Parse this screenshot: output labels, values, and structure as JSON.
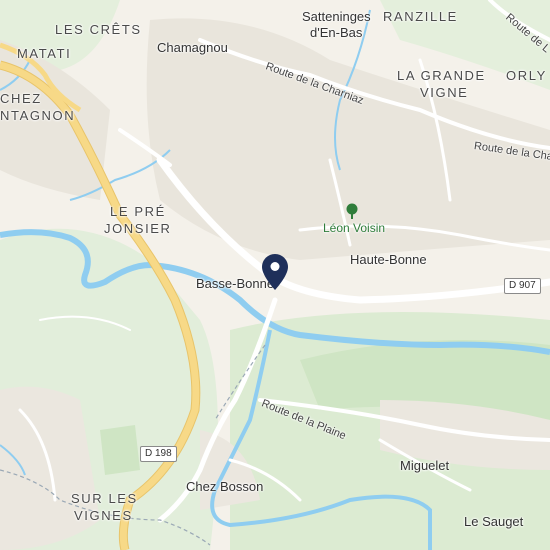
{
  "map": {
    "colors": {
      "land": "#f4f1ea",
      "green": "#dcebd2",
      "forest": "#cfe5c4",
      "water": "#8fcdf0",
      "major_road": "#f7d987",
      "road": "#ffffff",
      "built": "#e6e2d8",
      "pin": "#1e2f5a"
    },
    "labels": {
      "les_crets": "LES CRÊTS",
      "satteninges": "Satteninges",
      "den_bas": "d'En-Bas",
      "ranzille": "RANZILLE",
      "matati": "MATATI",
      "chamagnou": "Chamagnou",
      "la_grande": "LA GRANDE",
      "vigne": "VIGNE",
      "orly": "ORLY",
      "chez": "CHEZ",
      "ntagnon": "NTAGNON",
      "le_pre": "LE PRÉ",
      "jonsier": "JONSIER",
      "leon_voisin": "Léon Voisin",
      "haute_bonne": "Haute-Bonne",
      "basse_bonne": "Basse-Bonne",
      "miguelet": "Miguelet",
      "chez_bosson": "Chez Bosson",
      "sur_les": "SUR LES",
      "vignes": "VIGNES",
      "le_sauget": "Le Sauget"
    },
    "roads": {
      "charniaz": "Route de la Charniaz",
      "charniaz_east": "Route de la Char",
      "plaine": "Route de la Plaine",
      "top_right": "Route de L"
    },
    "shields": {
      "d907": "D 907",
      "d198": "D 198"
    },
    "icons": {
      "pin": "location-pin-icon",
      "park": "tree-icon"
    }
  }
}
